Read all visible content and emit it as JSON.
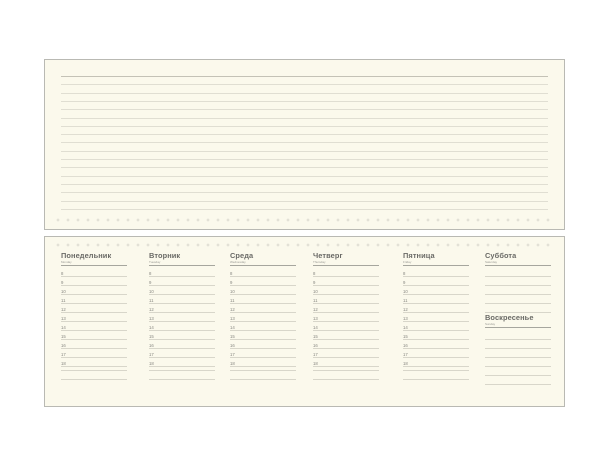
{
  "hours": [
    "8",
    "9",
    "10",
    "11",
    "12",
    "13",
    "14",
    "15",
    "16",
    "17",
    "18"
  ],
  "days": [
    {
      "key": "monday",
      "title": "Понедельник",
      "subtitle": "Monday"
    },
    {
      "key": "tuesday",
      "title": "Вторник",
      "subtitle": "Tuesday"
    },
    {
      "key": "wednesday",
      "title": "Среда",
      "subtitle": "Wednesday"
    },
    {
      "key": "thursday",
      "title": "Четверг",
      "subtitle": "Thursday"
    },
    {
      "key": "friday",
      "title": "Пятница",
      "subtitle": "Friday"
    },
    {
      "key": "saturday",
      "title": "Суббота",
      "subtitle": "Saturday"
    },
    {
      "key": "sunday",
      "title": "Воскресенье",
      "subtitle": "Sunday"
    }
  ]
}
